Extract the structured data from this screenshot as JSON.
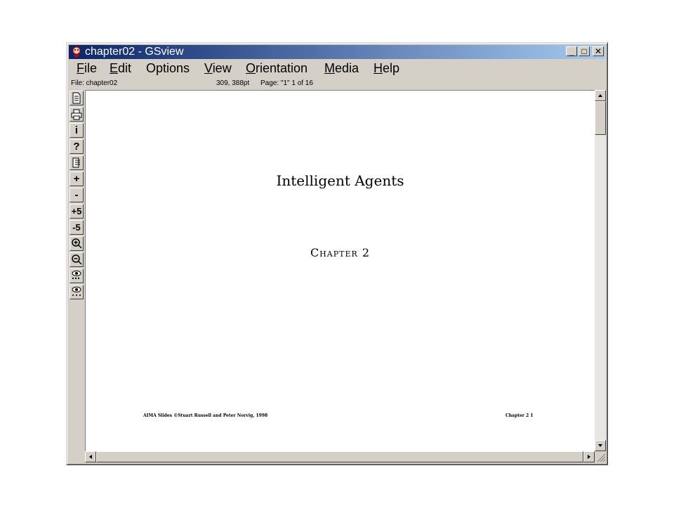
{
  "window": {
    "title": "chapter02 - GSview",
    "controls": {
      "minimize": "_",
      "maximize": "□",
      "close": "✕"
    }
  },
  "menu": [
    {
      "label": "File",
      "underline": "F",
      "rest": "ile"
    },
    {
      "label": "Edit",
      "underline": "E",
      "rest": "dit"
    },
    {
      "label": "Options",
      "underline": "",
      "rest": "Options"
    },
    {
      "label": "View",
      "underline": "V",
      "rest": "iew"
    },
    {
      "label": "Orientation",
      "underline": "O",
      "rest": "rientation"
    },
    {
      "label": "Media",
      "underline": "M",
      "rest": "edia"
    },
    {
      "label": "Help",
      "underline": "H",
      "rest": "elp"
    }
  ],
  "status": {
    "file": "File: chapter02",
    "coords": "309, 388pt",
    "page": "Page: \"1\"  1 of 16"
  },
  "toolbar": {
    "info": "i",
    "help": "?",
    "plus": "+",
    "minus": "-",
    "plus5": "+5",
    "minus5": "-5"
  },
  "document": {
    "title": "Intelligent Agents",
    "chapter": "Chapter 2",
    "footer_left": "AIMA Slides ©Stuart Russell and Peter Norvig, 1998",
    "footer_right": "Chapter 2     1"
  },
  "colors": {
    "titlebar_start": "#0a246a",
    "titlebar_end": "#a6caf0",
    "chrome": "#d4d0c8"
  }
}
